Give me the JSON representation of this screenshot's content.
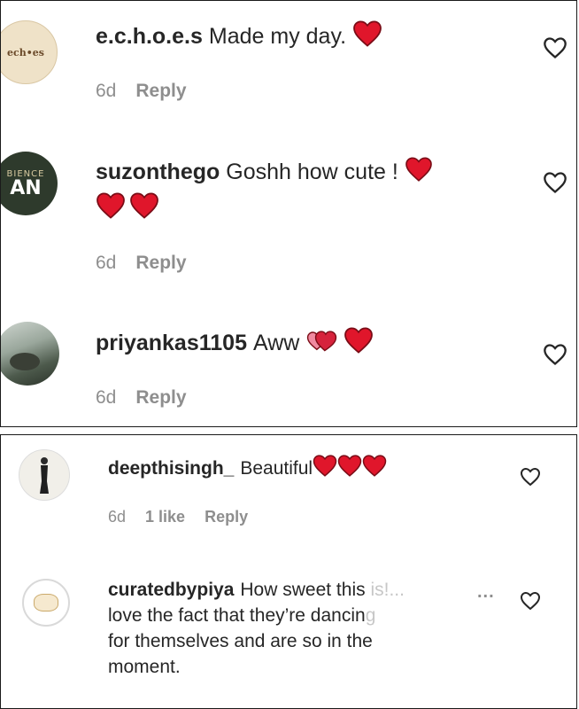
{
  "comments": [
    {
      "username": "e.c.h.o.e.s",
      "text": "Made my day.",
      "avatar_text": "ech•es",
      "time": "6d",
      "reply_label": "Reply"
    },
    {
      "username": "suzonthego",
      "text": "Goshh how cute !",
      "avatar_text_top": "BIENCE",
      "avatar_text_bottom": "AN",
      "time": "6d",
      "reply_label": "Reply"
    },
    {
      "username": "priyankas1105",
      "text": "Aww",
      "time": "6d",
      "reply_label": "Reply"
    },
    {
      "username": "deepthisingh_",
      "text": "Beautiful",
      "time": "6d",
      "likes_label": "1 like",
      "reply_label": "Reply"
    },
    {
      "username": "curatedbypiya",
      "text_line1": "How sweet this",
      "text_line1_faded": "is!...",
      "more_label": "...",
      "text_line2": "love the fact that they’re dancin",
      "text_line2_faded": "g",
      "text_line3": "for themselves and are so in the",
      "text_line4": "moment."
    }
  ],
  "icons": {
    "heart_red": "heart-icon",
    "heart_pink": "growing-heart-icon",
    "like": "heart-outline-icon"
  },
  "colors": {
    "heart_red": "#e0162b",
    "meta_gray": "#8e8e8e",
    "text": "#262626"
  }
}
